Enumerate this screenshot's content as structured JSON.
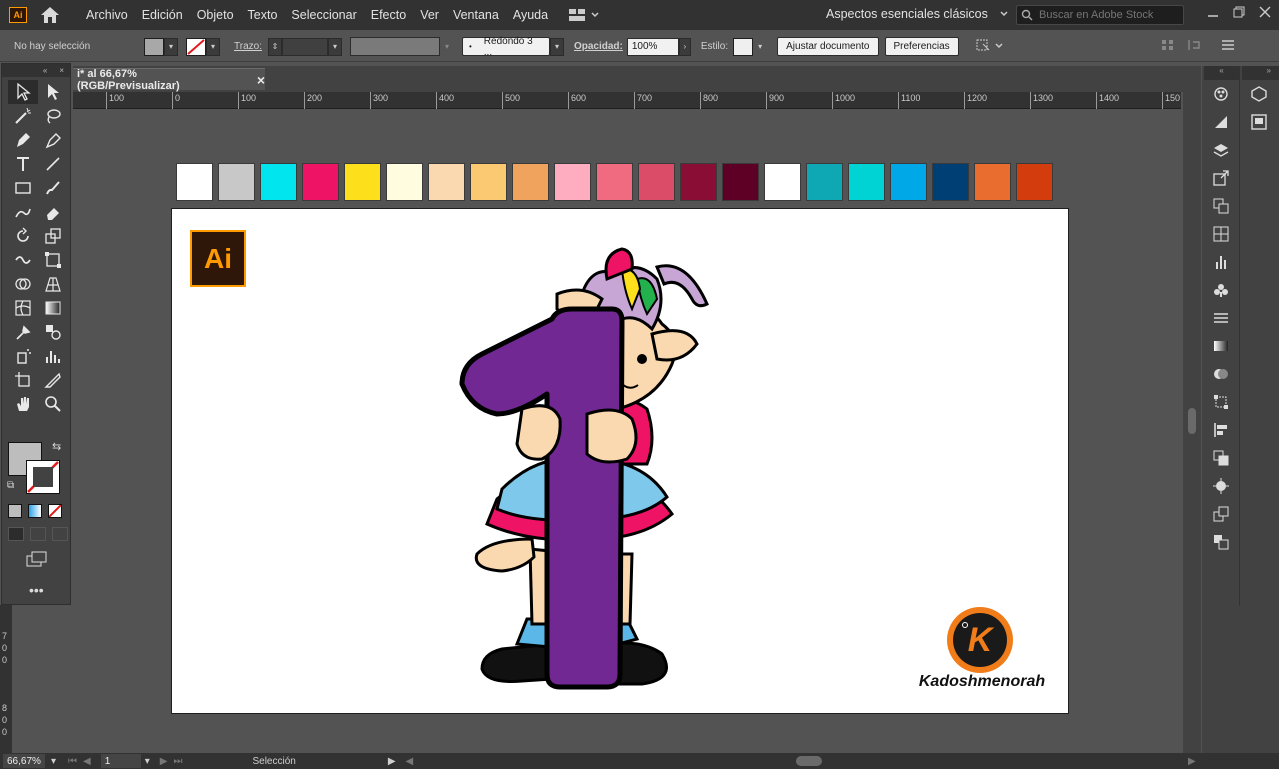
{
  "app": {
    "logo_text": "Ai"
  },
  "menu": [
    "Archivo",
    "Edición",
    "Objeto",
    "Texto",
    "Seleccionar",
    "Efecto",
    "Ver",
    "Ventana",
    "Ayuda"
  ],
  "workspace_label": "Aspectos esenciales clásicos",
  "stock_search": {
    "placeholder": "Buscar en Adobe Stock"
  },
  "control": {
    "selection": "No hay selección",
    "stroke_label": "Trazo:",
    "brush": "Redondo 3 ...",
    "opacity_label": "Opacidad:",
    "opacity_value": "100%",
    "style_label": "Estilo:",
    "adjust_button": "Ajustar documento",
    "prefs_button": "Preferencias"
  },
  "document_tab": {
    "title": "i* al 66,67% (RGB/Previsualizar)",
    "close": "×"
  },
  "ruler_h": [
    "100",
    "0",
    "100",
    "200",
    "300",
    "400",
    "500",
    "600",
    "700",
    "800",
    "900",
    "1000",
    "1100",
    "1200",
    "1300",
    "1400",
    "150"
  ],
  "ruler_v": [
    "7",
    "0",
    "0",
    "8",
    "0",
    "0"
  ],
  "swatches": [
    "#ffffff",
    "#c8c8c8",
    "#00e5ee",
    "#ee1364",
    "#fde01b",
    "#fffcdf",
    "#fbd9b0",
    "#fcc973",
    "#f0a35c",
    "#fdadbf",
    "#f06b80",
    "#db4c69",
    "#8a0d36",
    "#5e0026",
    "#ffffff",
    "#0ea8b5",
    "#00d3d4",
    "#01a8e8",
    "#003f74",
    "#ea6d30",
    "#d33c0c"
  ],
  "artwork": {
    "badge_text": "Ai",
    "brand_letter": "K",
    "brand_name": "Kadoshmenorah"
  },
  "status": {
    "zoom": "66,67%",
    "artboard_num": "1",
    "tool_name": "Selección"
  },
  "icons": [
    "home-icon",
    "search-icon",
    "selection-tool-icon",
    "direct-selection-tool-icon",
    "pen-tool-icon",
    "type-tool-icon",
    "hand-tool-icon",
    "zoom-tool-icon"
  ]
}
